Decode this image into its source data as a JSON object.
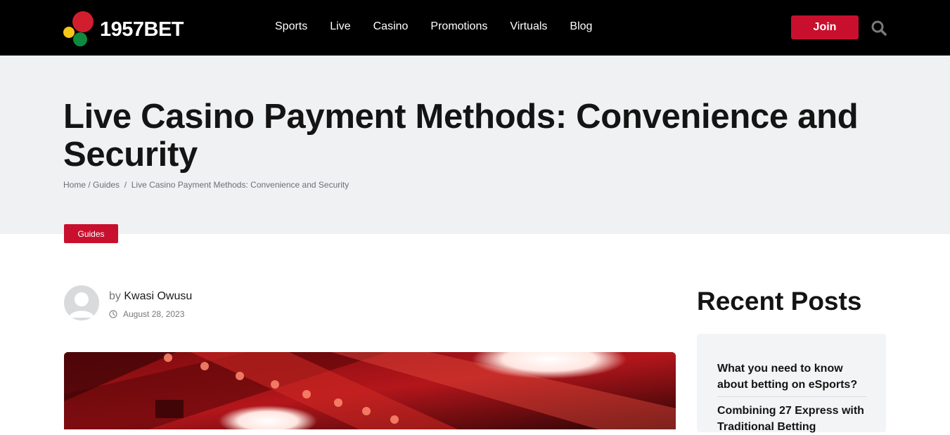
{
  "brand": {
    "name": "1957BET",
    "colors": {
      "red": "#d11e2e",
      "yellow": "#f5c518",
      "green": "#0e8a3e"
    }
  },
  "nav": {
    "items": [
      "Sports",
      "Live",
      "Casino",
      "Promotions",
      "Virtuals",
      "Blog"
    ]
  },
  "header": {
    "join_label": "Join",
    "search_icon": "search-icon"
  },
  "article": {
    "title": "Live Casino Payment Methods: Convenience and Security",
    "breadcrumb": {
      "home": "Home",
      "sep1": " / ",
      "section": "Guides",
      "sep2": "  /  ",
      "current": "Live Casino Payment Methods: Convenience and Security"
    },
    "category": "Guides",
    "author_prefix": "by",
    "author": "Kwasi Owusu",
    "date": "August 28, 2023"
  },
  "sidebar": {
    "heading": "Recent Posts",
    "posts": [
      {
        "title": "What you need to know about betting on eSports?"
      },
      {
        "title": "Combining 27 Express with Traditional Betting"
      }
    ]
  },
  "theme": {
    "accent": "#c8102e",
    "topbar": "#000000",
    "hero_bg": "#f0f1f3"
  }
}
